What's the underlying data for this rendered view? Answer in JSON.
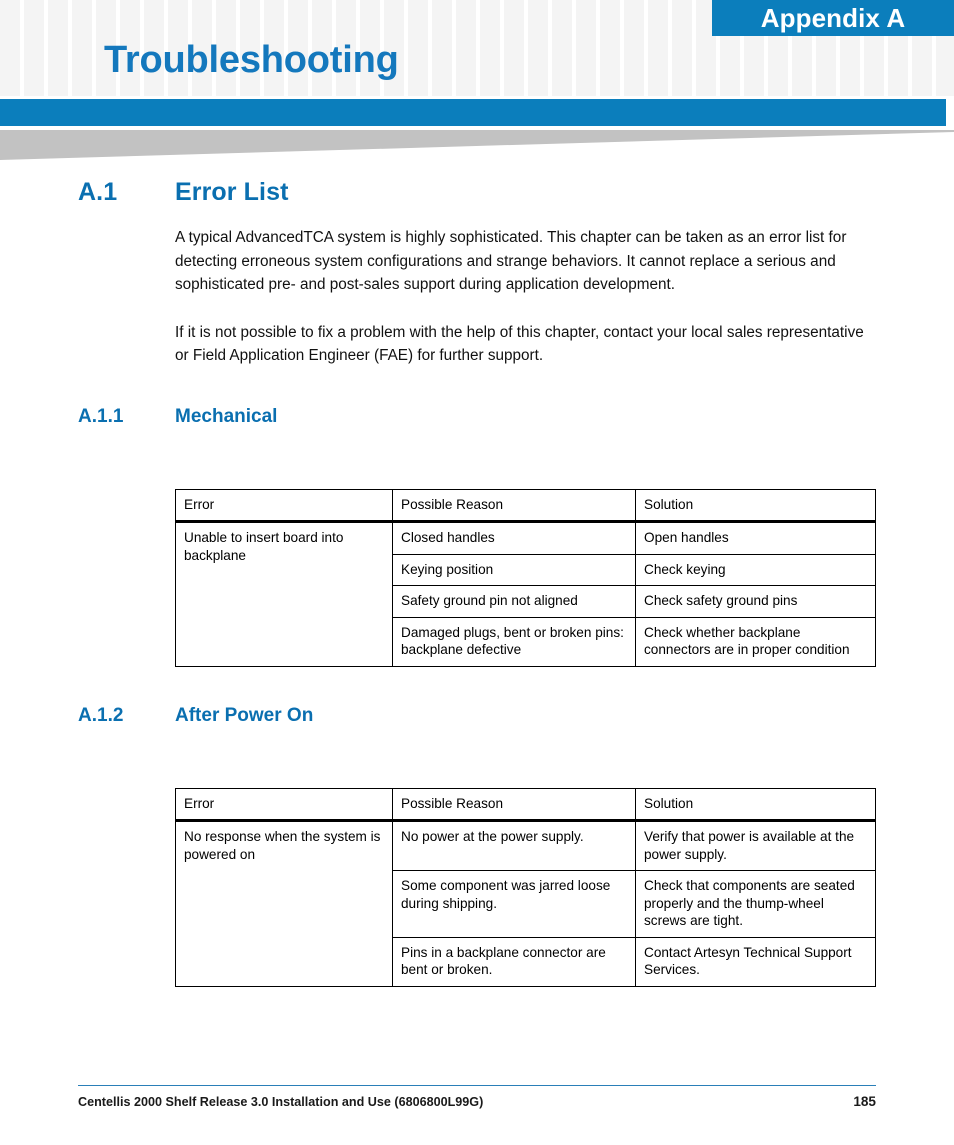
{
  "header": {
    "appendix_label": "Appendix A",
    "chapter_title": "Troubleshooting",
    "accent_blue": "#0b7ebc",
    "title_blue": "#1478bd",
    "wedge_gray": "#c2c2c2"
  },
  "sections": {
    "a1": {
      "number": "A.1",
      "title": "Error List",
      "paragraphs": [
        "A typical AdvancedTCA system is highly sophisticated. This chapter can be taken as an error list for detecting erroneous system configurations and strange behaviors. It cannot replace a serious and sophisticated pre- and post-sales support during application development.",
        "If it is not possible to fix a problem with the help of this chapter, contact your local sales representative or Field Application Engineer (FAE) for further support."
      ]
    },
    "a11": {
      "number": "A.1.1",
      "title": "Mechanical",
      "table": {
        "headers": [
          "Error",
          "Possible Reason",
          "Solution"
        ],
        "error_cell": "Unable to insert board into backplane",
        "rows": [
          {
            "reason": "Closed handles",
            "solution": "Open handles"
          },
          {
            "reason": "Keying position",
            "solution": "Check keying"
          },
          {
            "reason": "Safety ground pin not aligned",
            "solution": "Check safety ground pins"
          },
          {
            "reason": "Damaged plugs, bent or broken pins: backplane defective",
            "solution": "Check whether backplane connectors are in proper condition"
          }
        ]
      }
    },
    "a12": {
      "number": "A.1.2",
      "title": "After Power On",
      "table": {
        "headers": [
          "Error",
          "Possible Reason",
          "Solution"
        ],
        "error_cell": "No response when the system is powered on",
        "rows": [
          {
            "reason": "No power at the power supply.",
            "solution": "Verify that power is available at the power supply."
          },
          {
            "reason": "Some component was jarred loose during shipping.",
            "solution": "Check that components are seated properly and the thump-wheel screws are tight."
          },
          {
            "reason": "Pins in a backplane connector are bent or broken.",
            "solution": "Contact Artesyn Technical Support Services."
          }
        ]
      }
    }
  },
  "footer": {
    "document_title": "Centellis 2000 Shelf Release 3.0 Installation and Use (6806800L99G)",
    "page_number": "185"
  }
}
